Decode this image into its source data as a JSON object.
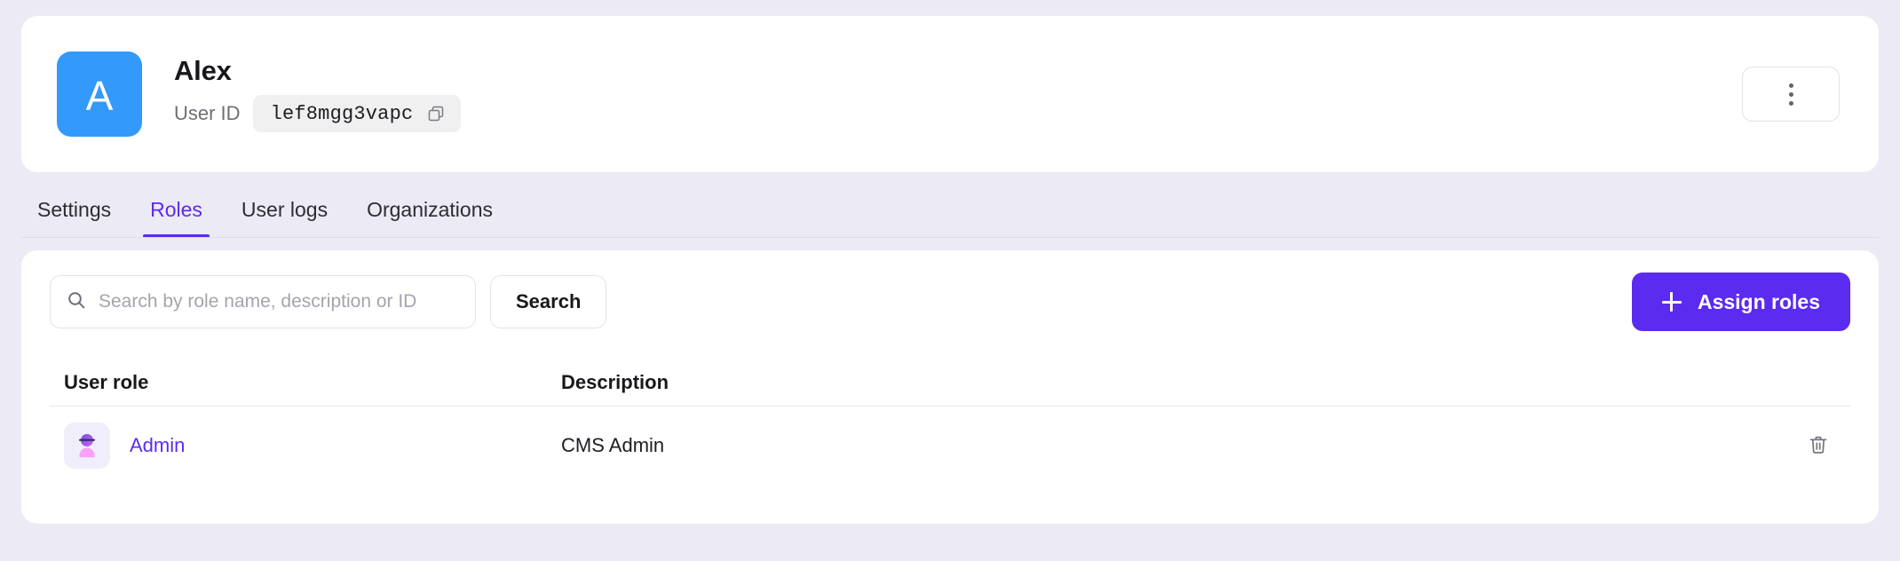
{
  "theme": {
    "page_background": "#eceaf4",
    "card_background": "#ffffff",
    "accent": "#5b2bf0",
    "avatar_background": "#3399fb",
    "role_icon_background": "#f0eefb",
    "chip_background": "#f0f0f0"
  },
  "header": {
    "avatar_initial": "A",
    "user_name": "Alex",
    "user_id_label": "User ID",
    "user_id_value": "lef8mgg3vapc",
    "copy_icon": "copy-icon",
    "menu_icon": "kebab-menu-icon"
  },
  "tabs": [
    {
      "label": "Settings",
      "active": false
    },
    {
      "label": "Roles",
      "active": true
    },
    {
      "label": "User logs",
      "active": false
    },
    {
      "label": "Organizations",
      "active": false
    }
  ],
  "toolbar": {
    "search_placeholder": "Search by role name, description or ID",
    "search_value": "",
    "search_icon": "search-icon",
    "search_button_label": "Search",
    "assign_button_label": "Assign roles",
    "assign_button_icon": "plus-icon"
  },
  "table": {
    "columns": [
      {
        "key": "role",
        "label": "User role"
      },
      {
        "key": "description",
        "label": "Description"
      }
    ],
    "rows": [
      {
        "role": "Admin",
        "role_icon": "user-avatar-icon",
        "description": "CMS Admin",
        "delete_icon": "trash-icon"
      }
    ]
  }
}
